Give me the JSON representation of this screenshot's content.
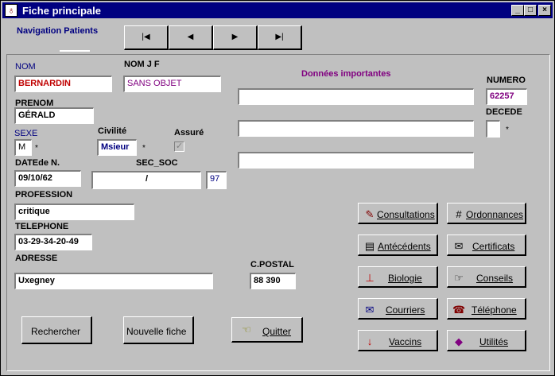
{
  "window": {
    "title": "Fiche principale"
  },
  "tab": {
    "label": "Navigation Patients"
  },
  "nav": {
    "first": "|◀",
    "prev": "◀",
    "next": "▶",
    "last": "▶|"
  },
  "labels": {
    "nom": "NOM",
    "nom_jf": "NOM J F",
    "prenom": "PRENOM",
    "sexe": "SEXE",
    "civilite": "Civilité",
    "assure": "Assuré",
    "date_naissance": "DATEde N.",
    "sec_soc": "SEC_SOC",
    "profession": "PROFESSION",
    "telephone": "TELEPHONE",
    "adresse": "ADRESSE",
    "cpostal": "C.POSTAL",
    "donnees_importantes": "Données importantes",
    "numero": "NUMERO",
    "decede": "DECEDE"
  },
  "fields": {
    "nom": "BERNARDIN",
    "nom_jf": "SANS OBJET",
    "prenom": "GÉRALD",
    "sexe": "M",
    "civilite": "Msieur",
    "date_naissance": "09/10/62",
    "sec_soc": "/",
    "sec_soc_cle": "97",
    "profession": "critique",
    "telephone": "03-29-34-20-49",
    "adresse": "Uxegney",
    "cpostal": "88 390",
    "numero": "62257",
    "donnees1": "",
    "donnees2": "",
    "donnees3": "",
    "decede": ""
  },
  "star": "*",
  "buttons": {
    "consultations": "Consultations",
    "ordonnances": "Ordonnances",
    "antecedents": "Antécédents",
    "certificats": "Certificats",
    "biologie": "Biologie",
    "conseils": "Conseils",
    "courriers": "Courriers",
    "telephone": "Téléphone",
    "vaccins": "Vaccins",
    "utilites": "Utilités",
    "rechercher": "Rechercher",
    "nouvelle_fiche": "Nouvelle fiche",
    "quitter": "Quitter"
  }
}
